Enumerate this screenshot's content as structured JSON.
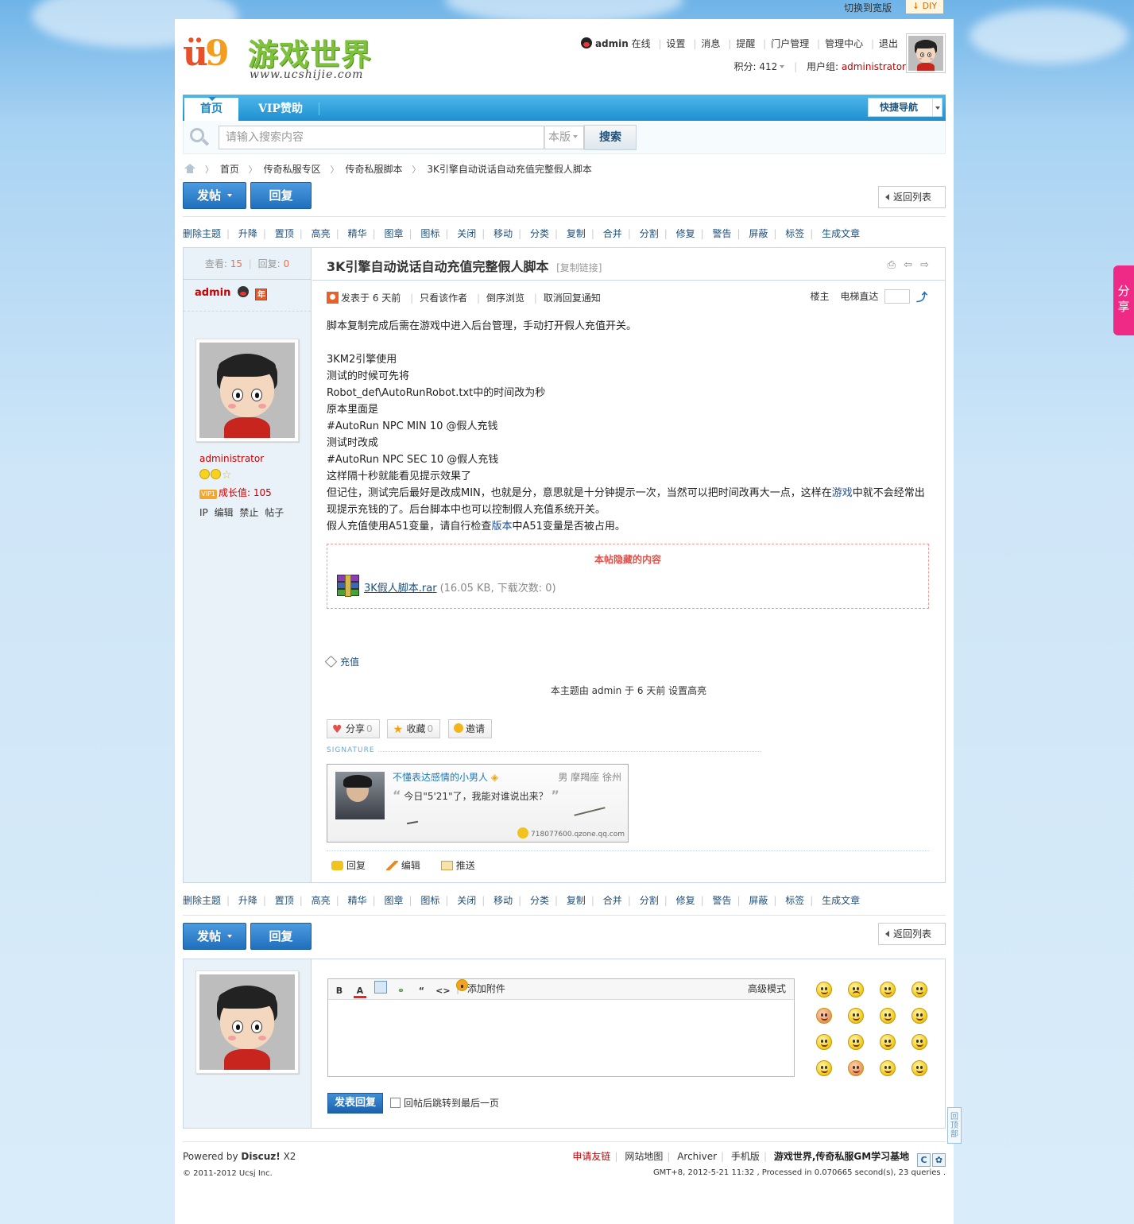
{
  "topbar": {
    "switch_label": "切换到宽版",
    "diy_label": "DIY"
  },
  "header": {
    "logo_text": "游戏世界",
    "logo_url": "www.ucshijie.com",
    "user": {
      "name": "admin",
      "status": "在线"
    },
    "menu": [
      "设置",
      "消息",
      "提醒",
      "门户管理",
      "管理中心",
      "退出"
    ],
    "points_label": "积分: 412",
    "group_label": "用户组:",
    "group_value": "administrator"
  },
  "nav": {
    "tabs": [
      "首页",
      "VIP赞助"
    ],
    "quick_nav": "快捷导航"
  },
  "search": {
    "placeholder": "请输入搜索内容",
    "scope": "本版",
    "button": "搜索"
  },
  "breadcrumb": [
    "首页",
    "传奇私服专区",
    "传奇私服脚本",
    "3K引擎自动说话自动充值完整假人脚本"
  ],
  "buttons": {
    "post": "发帖",
    "reply": "回复",
    "back": "返回列表"
  },
  "mod_actions": [
    "删除主题",
    "升降",
    "置顶",
    "高亮",
    "精华",
    "图章",
    "图标",
    "关闭",
    "移动",
    "分类",
    "复制",
    "合并",
    "分割",
    "修复",
    "警告",
    "屏蔽",
    "标签",
    "生成文章"
  ],
  "thread": {
    "views_label": "查看:",
    "views": "15",
    "replies_label": "回复:",
    "replies": "0",
    "title": "3K引擎自动说话自动充值完整假人脚本",
    "copy_link": "[复制链接]",
    "tools": "⎙ ⇦ ⇨"
  },
  "author": {
    "name": "admin",
    "badge": "年",
    "group": "administrator",
    "growth": "成长值: 105",
    "vip_badge": "VIP1",
    "links": "IP 编辑 禁止 帖子"
  },
  "post_meta": {
    "posted": "发表于 6 天前",
    "only_author": "只看该作者",
    "reverse": "倒序浏览",
    "cancel_notify": "取消回复通知",
    "floor": "楼主",
    "elevator": "电梯直达"
  },
  "content": {
    "lines": [
      "脚本复制完成后需在游戏中进入后台管理，手动打开假人充值开关。",
      "",
      "3KM2引擎使用",
      "测试的时候可先将",
      "Robot_def\\AutoRunRobot.txt中的时间改为秒",
      "原本里面是",
      "#AutoRun NPC MIN 10 @假人充钱",
      "测试时改成",
      "#AutoRun NPC SEC 10 @假人充钱",
      "这样隔十秒就能看见提示效果了"
    ],
    "para2_a": "但记住，测试完后最好是改成MIN，也就是分，意思就是十分钟提示一次，当然可以把时间改再大一点，这样在",
    "para2_kw": "游戏",
    "para2_b": "中就不会经常出现提示充钱的了。后台脚本中也可以控制假人充值系统开关。",
    "para3_a": "假人充值使用A51变量，请自行检查",
    "para3_kw": "版本",
    "para3_b": "中A51变量是否被占用。"
  },
  "hidden": {
    "title": "本帖隐藏的内容",
    "file_name": "3K假人脚本.rar",
    "file_info": "(16.05 KB, 下载次数: 0)"
  },
  "tag": "充值",
  "mod_info": "本主题由 admin 于 6 天前 设置高亮",
  "actions": [
    {
      "label": "分享",
      "count": "0"
    },
    {
      "label": "收藏",
      "count": "0"
    },
    {
      "label": "邀请",
      "count": ""
    }
  ],
  "signature": {
    "label": "SIGNATURE",
    "name": "不懂表达感情的小男人",
    "loc": "男 摩羯座 徐州",
    "quote": "今日\"5'21\"了，我能对谁说出来？",
    "qzone": "718077600.qzone.qq.com"
  },
  "post_foot": [
    "回复",
    "编辑",
    "推送"
  ],
  "editor": {
    "tools": [
      "B",
      "A",
      "",
      "",
      "“",
      "<>",
      ""
    ],
    "attach": "添加附件",
    "advanced": "高级模式",
    "submit": "发表回复",
    "jump_label": "回帖后跳转到最后一页"
  },
  "footer": {
    "powered": "Powered by",
    "brand": "Discuz!",
    "version": "X2",
    "copyright": "© 2011-2012 Ucsj Inc.",
    "links": [
      "申请友链",
      "网站地图",
      "Archiver",
      "手机版",
      "游戏世界,传奇私服GM学习基地"
    ],
    "info": "GMT+8, 2012-5-21 11:32 , Processed in 0.070665 second(s), 23 queries ."
  },
  "share_tab": "分享",
  "totop": "回顶部",
  "colors": {
    "accent": "#1e88c7",
    "admin_red": "#cc0000",
    "share_pink": "#ef2a86"
  }
}
